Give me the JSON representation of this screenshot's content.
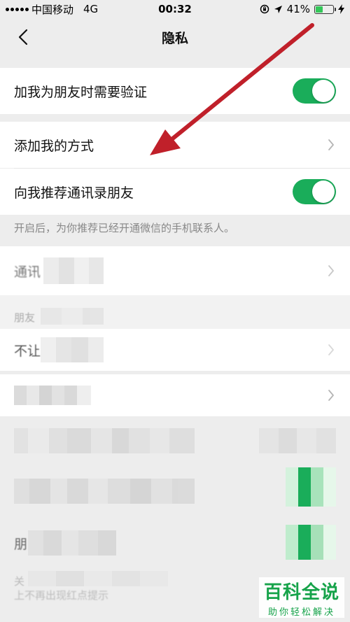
{
  "status_bar": {
    "carrier": "中国移动",
    "network": "4G",
    "time": "00:32",
    "battery": "41%",
    "battery_level": 0.41
  },
  "nav": {
    "title": "隐私",
    "back_icon": "chevron-left-icon"
  },
  "settings": {
    "verify_label": "加我为朋友时需要验证",
    "verify_on": true,
    "add_methods_label": "添加我的方式",
    "recommend_contacts_label": "向我推荐通讯录朋友",
    "recommend_contacts_on": true,
    "recommend_hint": "开启后，为你推荐已经开通微信的手机联系人。"
  },
  "blurred": {
    "blacklist_label": "通讯",
    "moments_section": "朋友",
    "row_not_let": "不让",
    "row_partial_1": "关",
    "row_partial_2": "上不再出现红点提示",
    "row_partial_3": "朋"
  },
  "watermark": {
    "title": "百科全说",
    "subtitle": "助你轻松解决"
  },
  "colors": {
    "toggle_on": "#1aad5a",
    "background": "#ededed",
    "arrow": "#c0202a"
  }
}
